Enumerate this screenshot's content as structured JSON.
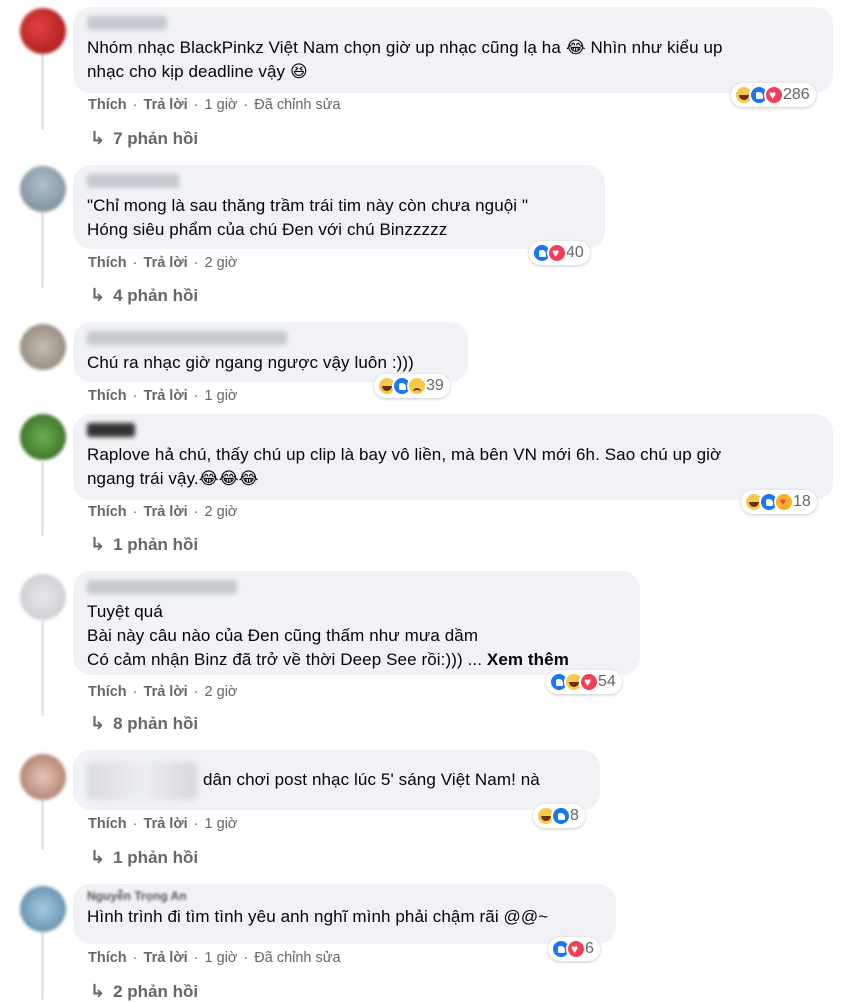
{
  "comments": [
    {
      "avatar_color": "#c72828",
      "text": "Nhóm nhạc BlackPinkz Việt Nam chọn giờ up nhạc cũng lạ ha 😂 Nhìn như kiểu up\nnhạc cho kịp deadline vậy 😆",
      "like_label": "Thích",
      "reply_label": "Trả lời",
      "time": "1 giờ",
      "edited_label": "Đã chỉnh sửa",
      "reaction_count": "286",
      "reaction_icons": [
        "haha-icon",
        "like-icon",
        "love-icon"
      ],
      "replies_label": "7 phản hồi"
    },
    {
      "avatar_color": "#8fa3b0",
      "text": "\"Chỉ mong là sau thăng trầm trái tim này còn chưa nguội \"\nHóng siêu phẩm của chú Đen với chú Binzzzzz",
      "like_label": "Thích",
      "reply_label": "Trả lời",
      "time": "2 giờ",
      "reaction_count": "40",
      "reaction_icons": [
        "like-icon",
        "love-icon"
      ],
      "replies_label": "4 phản hồi"
    },
    {
      "avatar_color": "#a3998c",
      "text": "Chú ra nhạc giờ ngang ngược vậy luôn :)))",
      "like_label": "Thích",
      "reply_label": "Trả lời",
      "time": "1 giờ",
      "reaction_count": "39",
      "reaction_icons": [
        "haha-icon",
        "like-icon",
        "sad-icon"
      ]
    },
    {
      "avatar_color": "#4e8a3a",
      "text": "Raplove hả chú, thấy chú up clip là bay vô liền, mà bên VN mới 6h. Sao chú up giờ\nngang trái vậy.😂😂😂",
      "like_label": "Thích",
      "reply_label": "Trả lời",
      "time": "2 giờ",
      "reaction_count": "18",
      "reaction_icons": [
        "haha-icon",
        "like-icon",
        "care-icon"
      ],
      "replies_label": "1 phản hồi"
    },
    {
      "avatar_color": "#d5d7da",
      "text": "Tuyệt quá\nBài này câu nào của Đen cũng thấm như mưa dầm\nCó cảm nhận Binz đã trở về thời Deep See rồi:))) ... ",
      "see_more": "Xem thêm",
      "like_label": "Thích",
      "reply_label": "Trả lời",
      "time": "2 giờ",
      "reaction_count": "54",
      "reaction_icons": [
        "like-icon",
        "haha-icon",
        "love-icon"
      ],
      "replies_label": "8 phản hồi"
    },
    {
      "avatar_color": "#c9a08f",
      "text": "dân chơi post nhạc lúc 5' sáng Việt Nam! nà",
      "like_label": "Thích",
      "reply_label": "Trả lời",
      "time": "1 giờ",
      "reaction_count": "8",
      "reaction_icons": [
        "haha-icon",
        "like-icon"
      ],
      "replies_label": "1 phản hồi"
    },
    {
      "avatar_color": "#7fa8c4",
      "author": "Nguyễn Trọng An",
      "text": "Hình trình đi tìm tình yêu anh nghĩ mình phải chậm rãi @@~",
      "like_label": "Thích",
      "reply_label": "Trả lời",
      "time": "1 giờ",
      "edited_label": "Đã chỉnh sửa",
      "reaction_count": "6",
      "reaction_icons": [
        "like-icon",
        "love-icon"
      ],
      "replies_label": "2 phản hồi"
    }
  ]
}
